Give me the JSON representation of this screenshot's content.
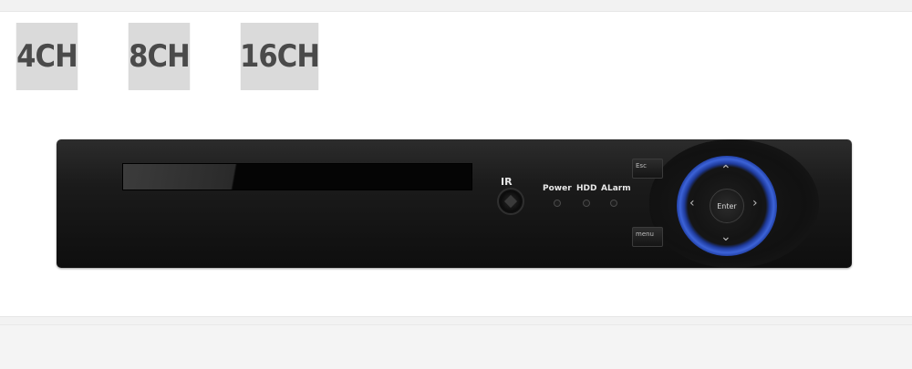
{
  "channel_options": [
    "4CH",
    "8CH",
    "16CH"
  ],
  "device": {
    "ir_label": "IR",
    "indicators": {
      "power": "Power",
      "hdd": "HDD",
      "alarm": "ALarm"
    },
    "buttons": {
      "esc": "Esc",
      "menu": "menu",
      "enter": "Enter"
    },
    "arrows": {
      "up": "^",
      "down": "v",
      "left": "<",
      "right": ">"
    }
  },
  "colors": {
    "badge_bg": "#dadada",
    "badge_text": "#4a4a4a",
    "device_body": "#161616",
    "ring_accent": "#3c63d8"
  }
}
